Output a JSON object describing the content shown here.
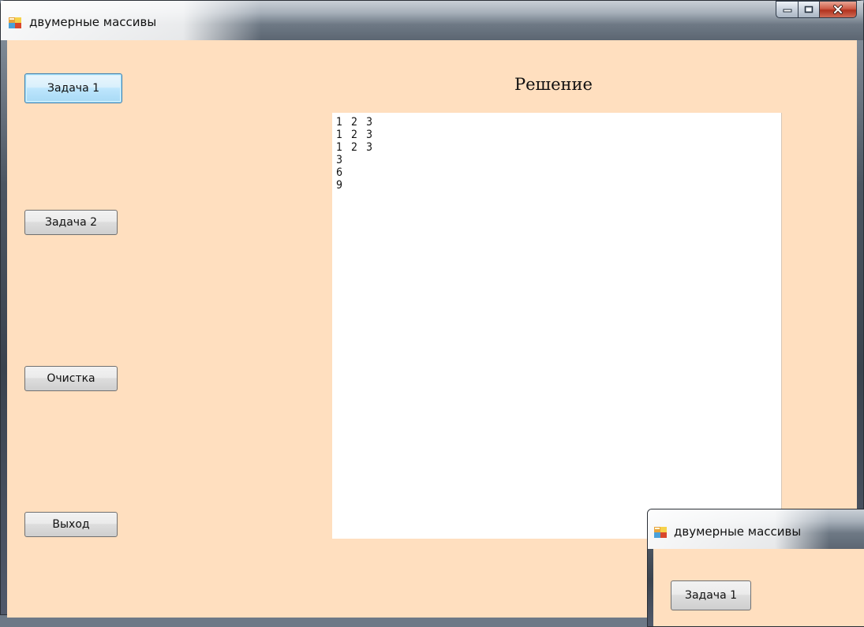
{
  "window": {
    "title": "двумерные массивы"
  },
  "buttons": {
    "task1": "Задача 1",
    "task2": "Задача 2",
    "clear": "Очистка",
    "exit": "Выход"
  },
  "solution": {
    "heading": "Решение",
    "rows": [
      [
        "1",
        "2",
        "3"
      ],
      [
        "1",
        "2",
        "3"
      ],
      [
        "1",
        "2",
        "3"
      ],
      [
        "3"
      ],
      [
        "6"
      ],
      [
        "9"
      ]
    ]
  },
  "second_window": {
    "title": "двумерные массивы",
    "task1": "Задача 1"
  },
  "colors": {
    "form_background": "#ffdfbf",
    "output_background": "#ffffff"
  },
  "icons": {
    "app": "windows-form-icon",
    "minimize": "minimize-icon",
    "maximize": "maximize-icon",
    "close": "close-icon"
  }
}
